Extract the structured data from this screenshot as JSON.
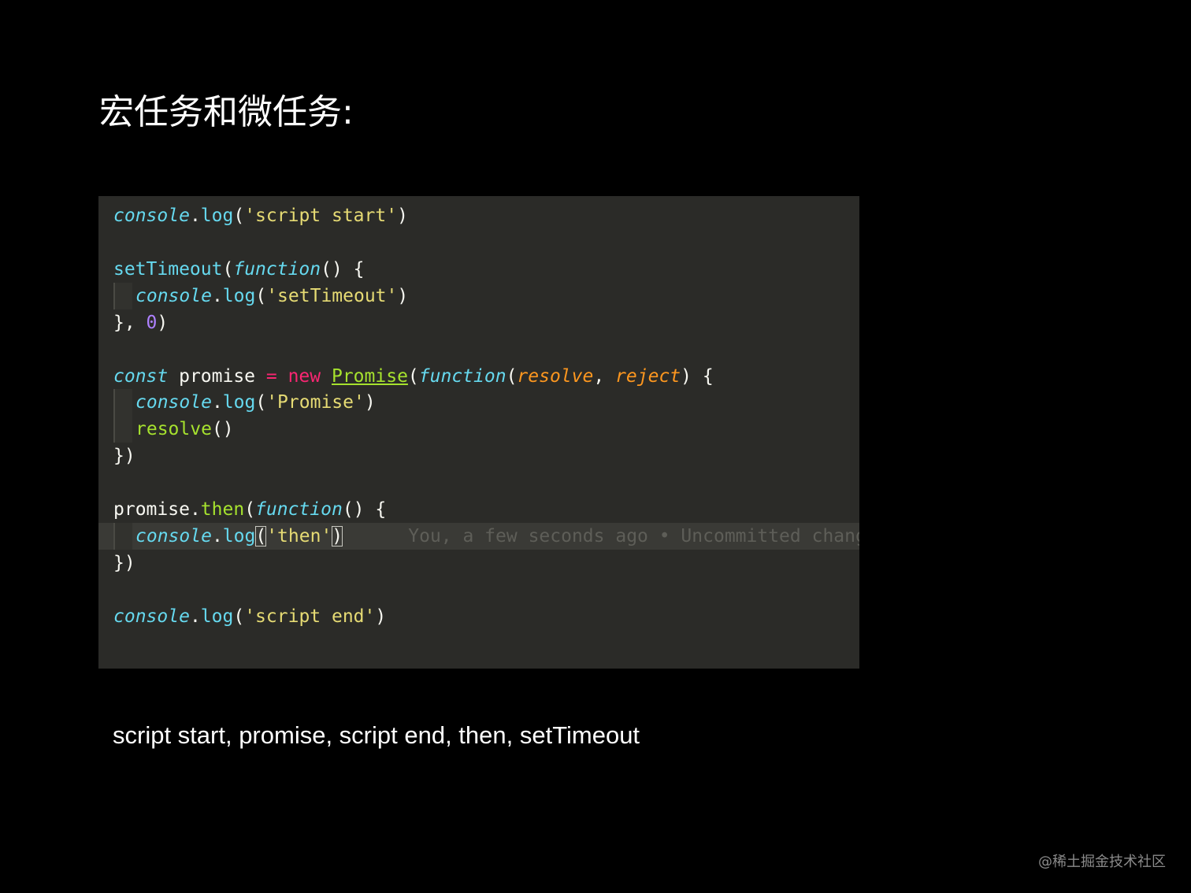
{
  "slide": {
    "title": "宏任务和微任务:",
    "answer": "script start, promise, script end, then, setTimeout",
    "watermark": "@稀土掘金技术社区"
  },
  "code": {
    "line1": {
      "console": "console",
      "dot": ".",
      "log": "log",
      "open": "(",
      "str": "'script start'",
      "close": ")"
    },
    "line2": {
      "setTimeout": "setTimeout",
      "open": "(",
      "function": "function",
      "rest": "() {"
    },
    "line3": {
      "console": "console",
      "dot": ".",
      "log": "log",
      "open": "(",
      "str": "'setTimeout'",
      "close": ")"
    },
    "line4": {
      "pre": "}, ",
      "zero": "0",
      "close": ")"
    },
    "line5": {
      "const": "const",
      "promise": " promise ",
      "eq": "=",
      "new": " new ",
      "Promise": "Promise",
      "open": "(",
      "function": "function",
      "open2": "(",
      "resolve": "resolve",
      "comma": ", ",
      "reject": "reject",
      "close": ") {"
    },
    "line6": {
      "console": "console",
      "dot": ".",
      "log": "log",
      "open": "(",
      "str": "'Promise'",
      "close": ")"
    },
    "line7": {
      "resolve": "resolve",
      "parens": "()"
    },
    "line8": {
      "text": "})"
    },
    "line9": {
      "promise": "promise",
      "dot": ".",
      "then": "then",
      "open": "(",
      "function": "function",
      "rest": "() {"
    },
    "line10": {
      "console": "console",
      "dot": ".",
      "log": "log",
      "open": "(",
      "str": "'then'",
      "close": ")",
      "blame": "You, a few seconds ago • Uncommitted changes"
    },
    "line11": {
      "text": "})"
    },
    "line12": {
      "console": "console",
      "dot": ".",
      "log": "log",
      "open": "(",
      "str": "'script end'",
      "close": ")"
    }
  },
  "colors": {
    "background": "#000000",
    "editor_background": "#2b2b28",
    "cyan": "#66d9ef",
    "yellow": "#e6db74",
    "orange": "#fd971f",
    "pink": "#f92672",
    "green": "#a6e22e",
    "purple": "#ae81ff"
  }
}
